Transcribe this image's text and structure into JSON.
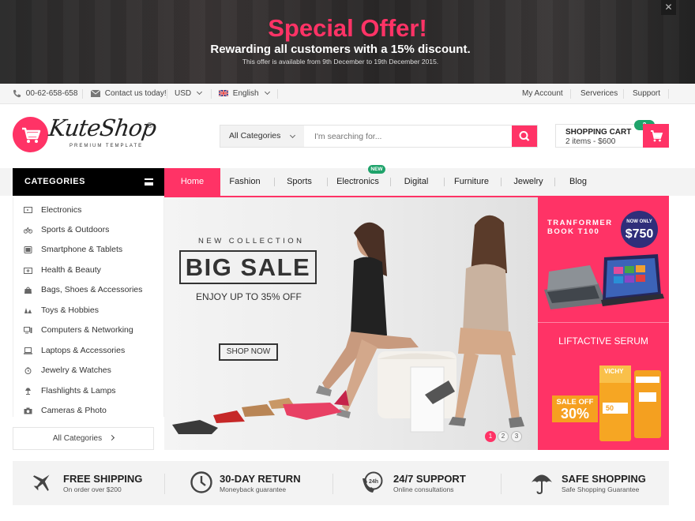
{
  "promo": {
    "title": "Special Offer!",
    "subtitle": "Rewarding all customers with a 15% discount.",
    "note": "This offer is available from 9th December to 19th December 2015.",
    "close": "✕"
  },
  "topbar": {
    "phone": "00-62-658-658",
    "contact": "Contact us today!",
    "currency": "USD",
    "language": "English",
    "links": [
      "My Account",
      "Serverices",
      "Support"
    ]
  },
  "logo": {
    "name": "KuteShop",
    "reg": "®",
    "tagline": "PREMIUM TEMPLATE"
  },
  "search": {
    "category": "All Categories",
    "placeholder": "I'm searching for..."
  },
  "cart": {
    "title": "SHOPPING CART",
    "summary": "2 items - $600",
    "count": "2"
  },
  "categories_header": "CATEGORIES",
  "nav": {
    "items": [
      "Home",
      "Fashion",
      "Sports",
      "Electronics",
      "Digital",
      "Furniture",
      "Jewelry",
      "Blog"
    ],
    "new_badge": "NEW"
  },
  "categories": [
    "Electronics",
    "Sports & Outdoors",
    "Smartphone & Tablets",
    "Health & Beauty",
    "Bags, Shoes & Accessories",
    "Toys & Hobbies",
    "Computers & Networking",
    "Laptops & Accessories",
    "Jewelry & Watches",
    "Flashlights & Lamps",
    "Cameras & Photo"
  ],
  "all_categories": "All Categories",
  "hero": {
    "kicker": "NEW COLLECTION",
    "headline": "BIG SALE",
    "offer": "ENJOY UP TO 35% OFF",
    "cta": "SHOP NOW",
    "slides": [
      "1",
      "2",
      "3"
    ],
    "active_slide": 1
  },
  "side_banner": {
    "product_line1": "TRANFORMER",
    "product_line2": "BOOK T100",
    "price_label": "NOW ONLY",
    "price": "$750",
    "serum": "LIFTACTIVE SERUM",
    "sale_label": "SALE OFF",
    "sale_value": "30%",
    "brand": "VICHY",
    "spf": "50"
  },
  "features": [
    {
      "title": "FREE SHIPPING",
      "sub": "On order over $200",
      "icon": "airplane-icon"
    },
    {
      "title": "30-DAY RETURN",
      "sub": "Moneyback guarantee",
      "icon": "clock-icon"
    },
    {
      "title": "24/7 SUPPORT",
      "sub": "Online consultations",
      "icon": "support-phone-icon"
    },
    {
      "title": "SAFE SHOPPING",
      "sub": "Safe Shopping Guarantee",
      "icon": "umbrella-icon"
    }
  ],
  "colors": {
    "accent": "#ff3366",
    "green_badge": "#1fa36b",
    "price_circle": "#2f2e7a",
    "sale_orange": "#f6a020"
  }
}
